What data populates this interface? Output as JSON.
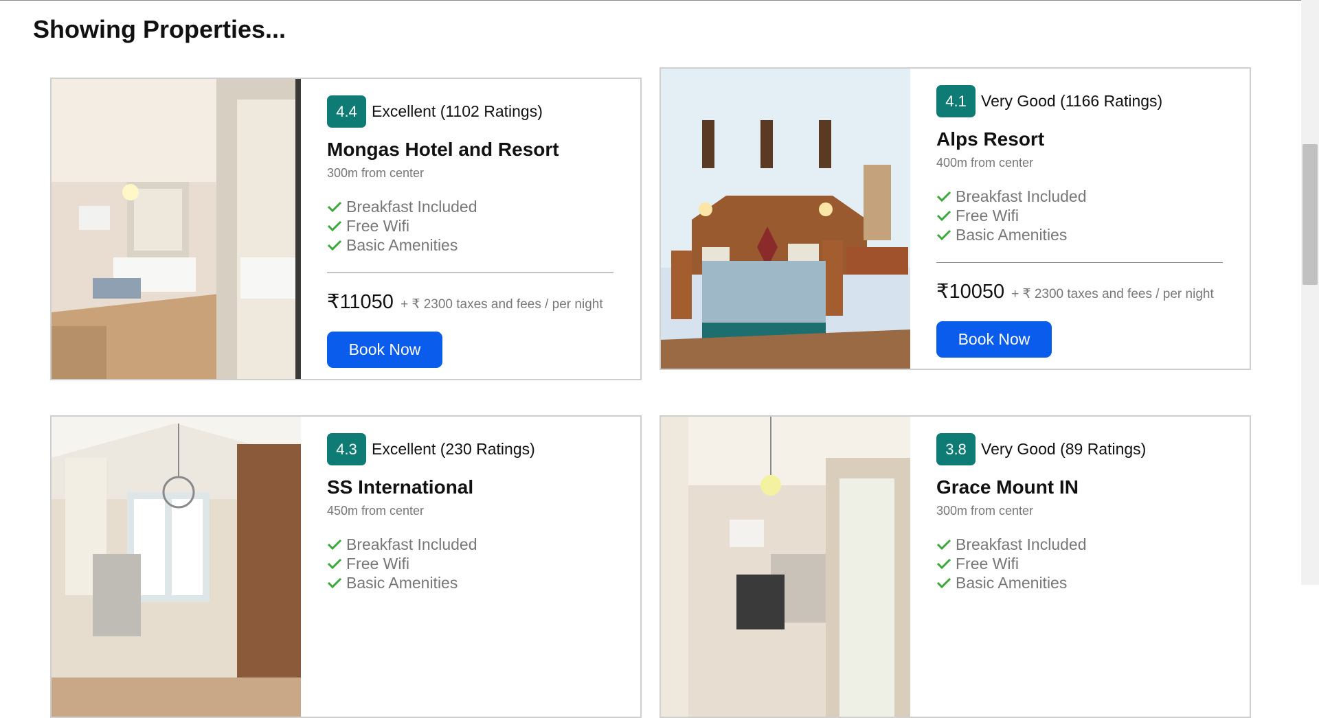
{
  "page": {
    "heading": "Showing Properties..."
  },
  "properties": [
    {
      "rating": "4.4",
      "rating_text": "Excellent (1102 Ratings)",
      "name": "Mongas Hotel and Resort",
      "distance": "300m from center",
      "amenities": [
        "Breakfast Included",
        "Free Wifi",
        "Basic Amenities"
      ],
      "price": "₹11050",
      "taxes": "+ ₹ 2300 taxes and fees / per night",
      "book_label": "Book Now",
      "image": "hotel-room-photo"
    },
    {
      "rating": "4.1",
      "rating_text": "Very Good (1166 Ratings)",
      "name": "Alps Resort",
      "distance": "400m from center",
      "amenities": [
        "Breakfast Included",
        "Free Wifi",
        "Basic Amenities"
      ],
      "price": "₹10050",
      "taxes": "+ ₹ 2300 taxes and fees / per night",
      "book_label": "Book Now",
      "image": "hotel-room-photo"
    },
    {
      "rating": "4.3",
      "rating_text": "Excellent (230 Ratings)",
      "name": "SS International",
      "distance": "450m from center",
      "amenities": [
        "Breakfast Included",
        "Free Wifi",
        "Basic Amenities"
      ],
      "price": "",
      "taxes": "",
      "book_label": "",
      "image": "hotel-room-photo"
    },
    {
      "rating": "3.8",
      "rating_text": "Very Good (89 Ratings)",
      "name": "Grace Mount IN",
      "distance": "300m from center",
      "amenities": [
        "Breakfast Included",
        "Free Wifi",
        "Basic Amenities"
      ],
      "price": "",
      "taxes": "",
      "book_label": "",
      "image": "hotel-room-photo"
    }
  ],
  "icons": {
    "amenity_icon": "check-icon"
  },
  "colors": {
    "rating_badge": "#0e7c75",
    "button": "#0a5ced",
    "check": "#3aa83a",
    "muted_text": "#777777",
    "card_border": "#cfcfcf"
  }
}
